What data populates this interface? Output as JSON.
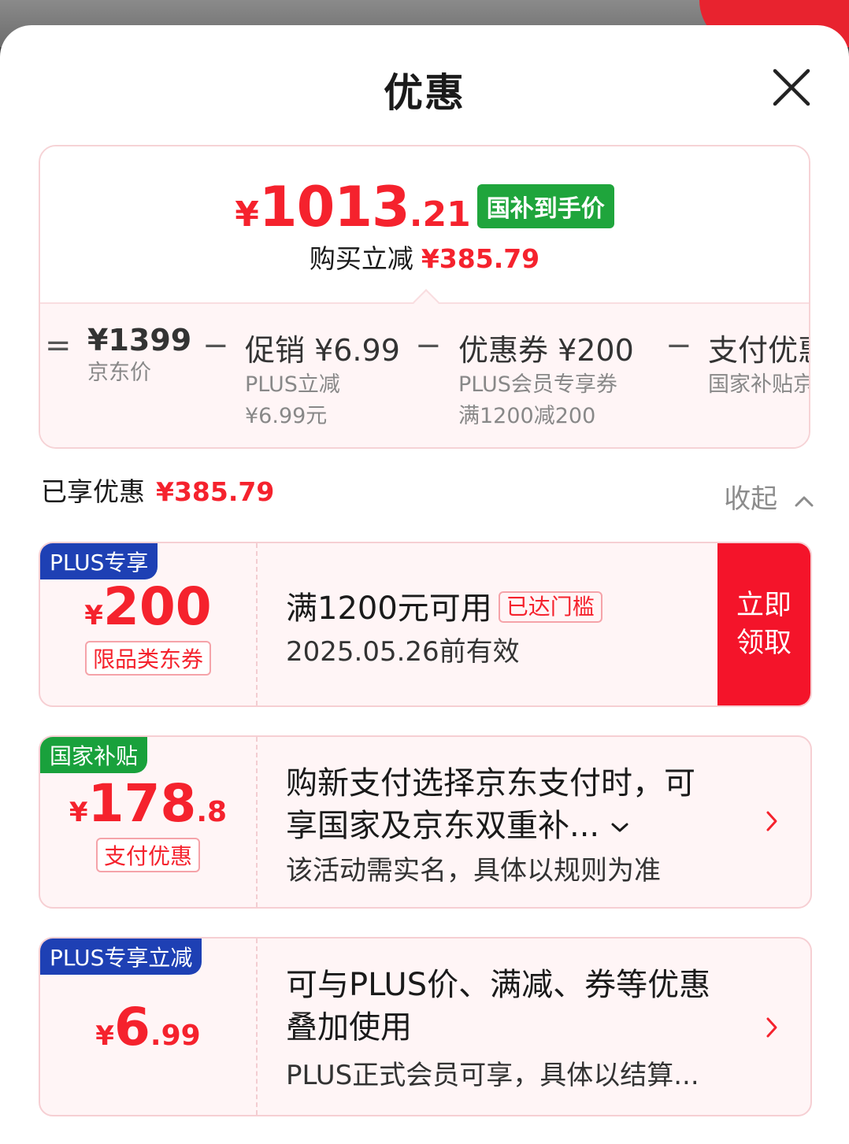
{
  "sheet": {
    "title": "优惠"
  },
  "summary": {
    "currency": "¥",
    "final_price_int": "1013",
    "final_price_dec": ".21",
    "final_price_tag": "国补到手价",
    "save_label": "购买立减",
    "save_value": "¥385.79",
    "formula": [
      {
        "op": "=",
        "main": "¥1399",
        "sub1": "京东价",
        "sub2": ""
      },
      {
        "op": "−",
        "main": "促销 ¥6.99",
        "sub1": "PLUS立减",
        "sub2": "¥6.99元"
      },
      {
        "op": "−",
        "main": "优惠券 ¥200",
        "sub1": "PLUS会员专享券",
        "sub2": "满1200减200"
      },
      {
        "op": "−",
        "main": "支付优惠",
        "sub1": "国家补贴京",
        "sub2": ""
      }
    ]
  },
  "enjoyed": {
    "label": "已享优惠",
    "value": "¥385.79",
    "collapse_label": "收起"
  },
  "coupons": [
    {
      "tag": "PLUS专享",
      "currency": "¥",
      "amount_int": "200",
      "amount_dec": "",
      "type": "限品类东券",
      "condition": "满1200元可用",
      "threshold_badge": "已达门槛",
      "validity": "2025.05.26前有效",
      "claim_line1": "立即",
      "claim_line2": "领取"
    },
    {
      "tag": "国家补贴",
      "currency": "¥",
      "amount_int": "178",
      "amount_dec": ".8",
      "type": "支付优惠",
      "desc_line1": "购新支付选择京东支付时，可",
      "desc_line2": "享国家及京东双重补...",
      "note": "该活动需实名，具体以规则为准"
    },
    {
      "tag": "PLUS专享立减",
      "currency": "¥",
      "amount_int": "6",
      "amount_dec": ".99",
      "desc_line1": "可与PLUS价、满减、券等优惠",
      "desc_line2": "叠加使用",
      "note": "PLUS正式会员可享，具体以结算..."
    }
  ],
  "colors": {
    "accent_red": "#f5222d",
    "plus_blue": "#1e40b4",
    "subsidy_green": "#19a13c"
  }
}
